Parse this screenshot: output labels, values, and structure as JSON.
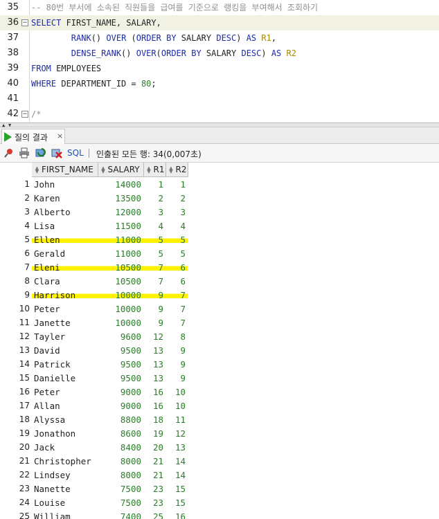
{
  "editor": {
    "lines": [
      {
        "n": "35",
        "code": "<span class=\"cmt\">-- 80번 부서에 소속된 직원들을 급여를 기준으로 랭킹을 부여해서 조회하기</span>",
        "fold": "",
        "current": false
      },
      {
        "n": "36",
        "code": "<span class=\"kw\">SELECT</span> FIRST_NAME, SALARY,",
        "fold": "−",
        "current": true
      },
      {
        "n": "37",
        "code": "        <span class=\"kw\">RANK</span>() <span class=\"kw\">OVER</span> (<span class=\"kw\">ORDER BY</span> SALARY <span class=\"kw\">DESC</span>) <span class=\"kw\">AS</span> <span class=\"alias\">R1</span>,",
        "fold": "",
        "current": false
      },
      {
        "n": "38",
        "code": "        <span class=\"kw\">DENSE_RANK</span>() <span class=\"kw\">OVER</span>(<span class=\"kw\">ORDER BY</span> SALARY <span class=\"kw\">DESC</span>) <span class=\"kw\">AS</span> <span class=\"alias\">R2</span>",
        "fold": "",
        "current": false
      },
      {
        "n": "39",
        "code": "<span class=\"kw\">FROM</span> EMPLOYEES",
        "fold": "",
        "current": false
      },
      {
        "n": "40",
        "code": "<span class=\"kw\">WHERE</span> DEPARTMENT_ID = <span class=\"num\">80</span>;",
        "fold": "",
        "current": false
      },
      {
        "n": "41",
        "code": "",
        "fold": "",
        "current": false
      },
      {
        "n": "42",
        "code": "<span class=\"cmt\">/*</span>",
        "fold": "−",
        "current": false
      }
    ]
  },
  "results_tab": {
    "label": "질의 결과",
    "close": "×"
  },
  "toolbar": {
    "sql_label": "SQL",
    "status": "인출된 모든 행: 34(0,007초)"
  },
  "grid": {
    "columns": [
      "FIRST_NAME",
      "SALARY",
      "R1",
      "R2"
    ],
    "rows": [
      {
        "n": "1",
        "first": "John",
        "salary": "14000",
        "r1": "1",
        "r2": "1",
        "hl": false
      },
      {
        "n": "2",
        "first": "Karen",
        "salary": "13500",
        "r1": "2",
        "r2": "2",
        "hl": false
      },
      {
        "n": "3",
        "first": "Alberto",
        "salary": "12000",
        "r1": "3",
        "r2": "3",
        "hl": false
      },
      {
        "n": "4",
        "first": "Lisa",
        "salary": "11500",
        "r1": "4",
        "r2": "4",
        "hl": false
      },
      {
        "n": "5",
        "first": "Ellen",
        "salary": "11000",
        "r1": "5",
        "r2": "5",
        "hl": true
      },
      {
        "n": "6",
        "first": "Gerald",
        "salary": "11000",
        "r1": "5",
        "r2": "5",
        "hl": false
      },
      {
        "n": "7",
        "first": "Eleni",
        "salary": "10500",
        "r1": "7",
        "r2": "6",
        "hl": true
      },
      {
        "n": "8",
        "first": "Clara",
        "salary": "10500",
        "r1": "7",
        "r2": "6",
        "hl": false
      },
      {
        "n": "9",
        "first": "Harrison",
        "salary": "10000",
        "r1": "9",
        "r2": "7",
        "hl": true
      },
      {
        "n": "10",
        "first": "Peter",
        "salary": "10000",
        "r1": "9",
        "r2": "7",
        "hl": false
      },
      {
        "n": "11",
        "first": "Janette",
        "salary": "10000",
        "r1": "9",
        "r2": "7",
        "hl": false
      },
      {
        "n": "12",
        "first": "Tayler",
        "salary": "9600",
        "r1": "12",
        "r2": "8",
        "hl": false
      },
      {
        "n": "13",
        "first": "David",
        "salary": "9500",
        "r1": "13",
        "r2": "9",
        "hl": false
      },
      {
        "n": "14",
        "first": "Patrick",
        "salary": "9500",
        "r1": "13",
        "r2": "9",
        "hl": false
      },
      {
        "n": "15",
        "first": "Danielle",
        "salary": "9500",
        "r1": "13",
        "r2": "9",
        "hl": false
      },
      {
        "n": "16",
        "first": "Peter",
        "salary": "9000",
        "r1": "16",
        "r2": "10",
        "hl": false
      },
      {
        "n": "17",
        "first": "Allan",
        "salary": "9000",
        "r1": "16",
        "r2": "10",
        "hl": false
      },
      {
        "n": "18",
        "first": "Alyssa",
        "salary": "8800",
        "r1": "18",
        "r2": "11",
        "hl": false
      },
      {
        "n": "19",
        "first": "Jonathon",
        "salary": "8600",
        "r1": "19",
        "r2": "12",
        "hl": false
      },
      {
        "n": "20",
        "first": "Jack",
        "salary": "8400",
        "r1": "20",
        "r2": "13",
        "hl": false
      },
      {
        "n": "21",
        "first": "Christopher",
        "salary": "8000",
        "r1": "21",
        "r2": "14",
        "hl": false
      },
      {
        "n": "22",
        "first": "Lindsey",
        "salary": "8000",
        "r1": "21",
        "r2": "14",
        "hl": false
      },
      {
        "n": "23",
        "first": "Nanette",
        "salary": "7500",
        "r1": "23",
        "r2": "15",
        "hl": false
      },
      {
        "n": "24",
        "first": "Louise",
        "salary": "7500",
        "r1": "23",
        "r2": "15",
        "hl": false
      },
      {
        "n": "25",
        "first": "William",
        "salary": "7400",
        "r1": "25",
        "r2": "16",
        "hl": false
      }
    ]
  },
  "colors": {
    "keyword": "#1d2ba8",
    "comment": "#909090",
    "number": "#2a7d2a",
    "alias": "#a68a00",
    "highlight": "#fff200"
  },
  "icons": [
    "pin-icon",
    "print-icon",
    "refresh-icon",
    "cancel-icon",
    "run-icon",
    "fold-icon",
    "sort-icon"
  ]
}
